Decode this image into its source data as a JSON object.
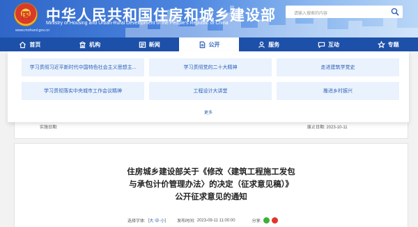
{
  "header": {
    "emblem_text": "国",
    "title": "中华人民共和国住房和城乡建设部",
    "subtitle": "Ministry of Housing and Urban-Rural Development of the People's Republic of China",
    "url": "www.mohurd.gov.cn",
    "search_placeholder": "请输入搜索的内容"
  },
  "nav": {
    "items": [
      {
        "label": "首页",
        "icon": "home-icon"
      },
      {
        "label": "机构",
        "icon": "building-icon"
      },
      {
        "label": "新闻",
        "icon": "news-icon"
      },
      {
        "label": "公开",
        "icon": "document-icon"
      },
      {
        "label": "服务",
        "icon": "service-icon"
      },
      {
        "label": "互动",
        "icon": "chat-icon"
      },
      {
        "label": "专题",
        "icon": "star-icon"
      }
    ],
    "active": "公开"
  },
  "dropdown": {
    "items": [
      "学习贯彻习近平新时代中国特色社会主义思想主...",
      "学习贯彻党的二十大精神",
      "走进建筑学党史",
      "学习贯彻落实中央城市工作会议精神",
      "工程设计大讲堂",
      "推进乡村振兴"
    ],
    "more_label": "更多"
  },
  "article": {
    "implement_date_label": "实施日期:",
    "effective_date_label": "废止日期:",
    "effective_date_value": "2023-10-11"
  },
  "content": {
    "title_line1": "住房城乡建设部关于《修改〈建筑工程施工发包",
    "title_line2": "与承包计价管理办法〉的决定（征求意见稿）》",
    "title_line3": "公开征求意见的通知",
    "font_label": "选择字体:",
    "font_open": "[",
    "font_large": "大",
    "font_sep1": "·",
    "font_medium": "中",
    "font_sep2": "·",
    "font_small": "小",
    "font_close": "]",
    "publish_label": "发布时间:",
    "publish_time": "2023-09-11 11:00:00",
    "share_label": "分享:"
  },
  "colors": {
    "brand_blue": "#1d50a8",
    "accent_blue": "#2b5fb8",
    "tile_bg": "#e9f2fd",
    "wechat": "#3cb034",
    "weibo": "#e0352b"
  }
}
